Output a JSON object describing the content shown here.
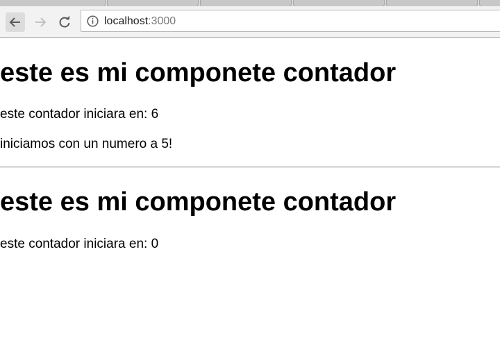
{
  "browser": {
    "url_host": "localhost",
    "url_port": ":3000"
  },
  "counters": [
    {
      "heading": "este es mi componete contador",
      "start_text": "este contador iniciara en: 6",
      "extra_text": "iniciamos con un numero a 5!"
    },
    {
      "heading": "este es mi componete contador",
      "start_text": "este contador iniciara en: 0"
    }
  ],
  "colors": {
    "toolbar": "#f2f2f2",
    "tabstrip": "#d9d9d9",
    "url_port": "#7a7a7a"
  }
}
